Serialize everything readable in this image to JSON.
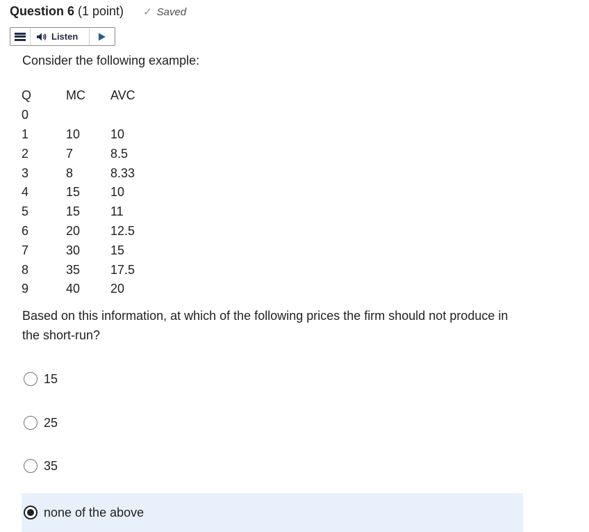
{
  "header": {
    "title": "Question 6",
    "points": "(1 point)",
    "saved": "Saved",
    "check_icon": "check-icon"
  },
  "listen_bar": {
    "label": "Listen"
  },
  "prompt": "Consider the following example:",
  "table": {
    "headers": [
      "Q",
      "MC",
      "AVC"
    ],
    "rows": [
      [
        "0",
        "",
        ""
      ],
      [
        "1",
        "10",
        "10"
      ],
      [
        "2",
        "7",
        "8.5"
      ],
      [
        "3",
        "8",
        "8.33"
      ],
      [
        "4",
        "15",
        "10"
      ],
      [
        "5",
        "15",
        "11"
      ],
      [
        "6",
        "20",
        "12.5"
      ],
      [
        "7",
        "30",
        "15"
      ],
      [
        "8",
        "35",
        "17.5"
      ],
      [
        "9",
        "40",
        "20"
      ]
    ]
  },
  "question": "Based on this information, at which of the following prices the firm should not produce in the short-run?",
  "options": [
    {
      "label": "15",
      "selected": false
    },
    {
      "label": "25",
      "selected": false
    },
    {
      "label": "35",
      "selected": false
    },
    {
      "label": "none of the above",
      "selected": true
    }
  ],
  "colors": {
    "selected_bg": "#e8f1fb",
    "text": "#202122"
  }
}
